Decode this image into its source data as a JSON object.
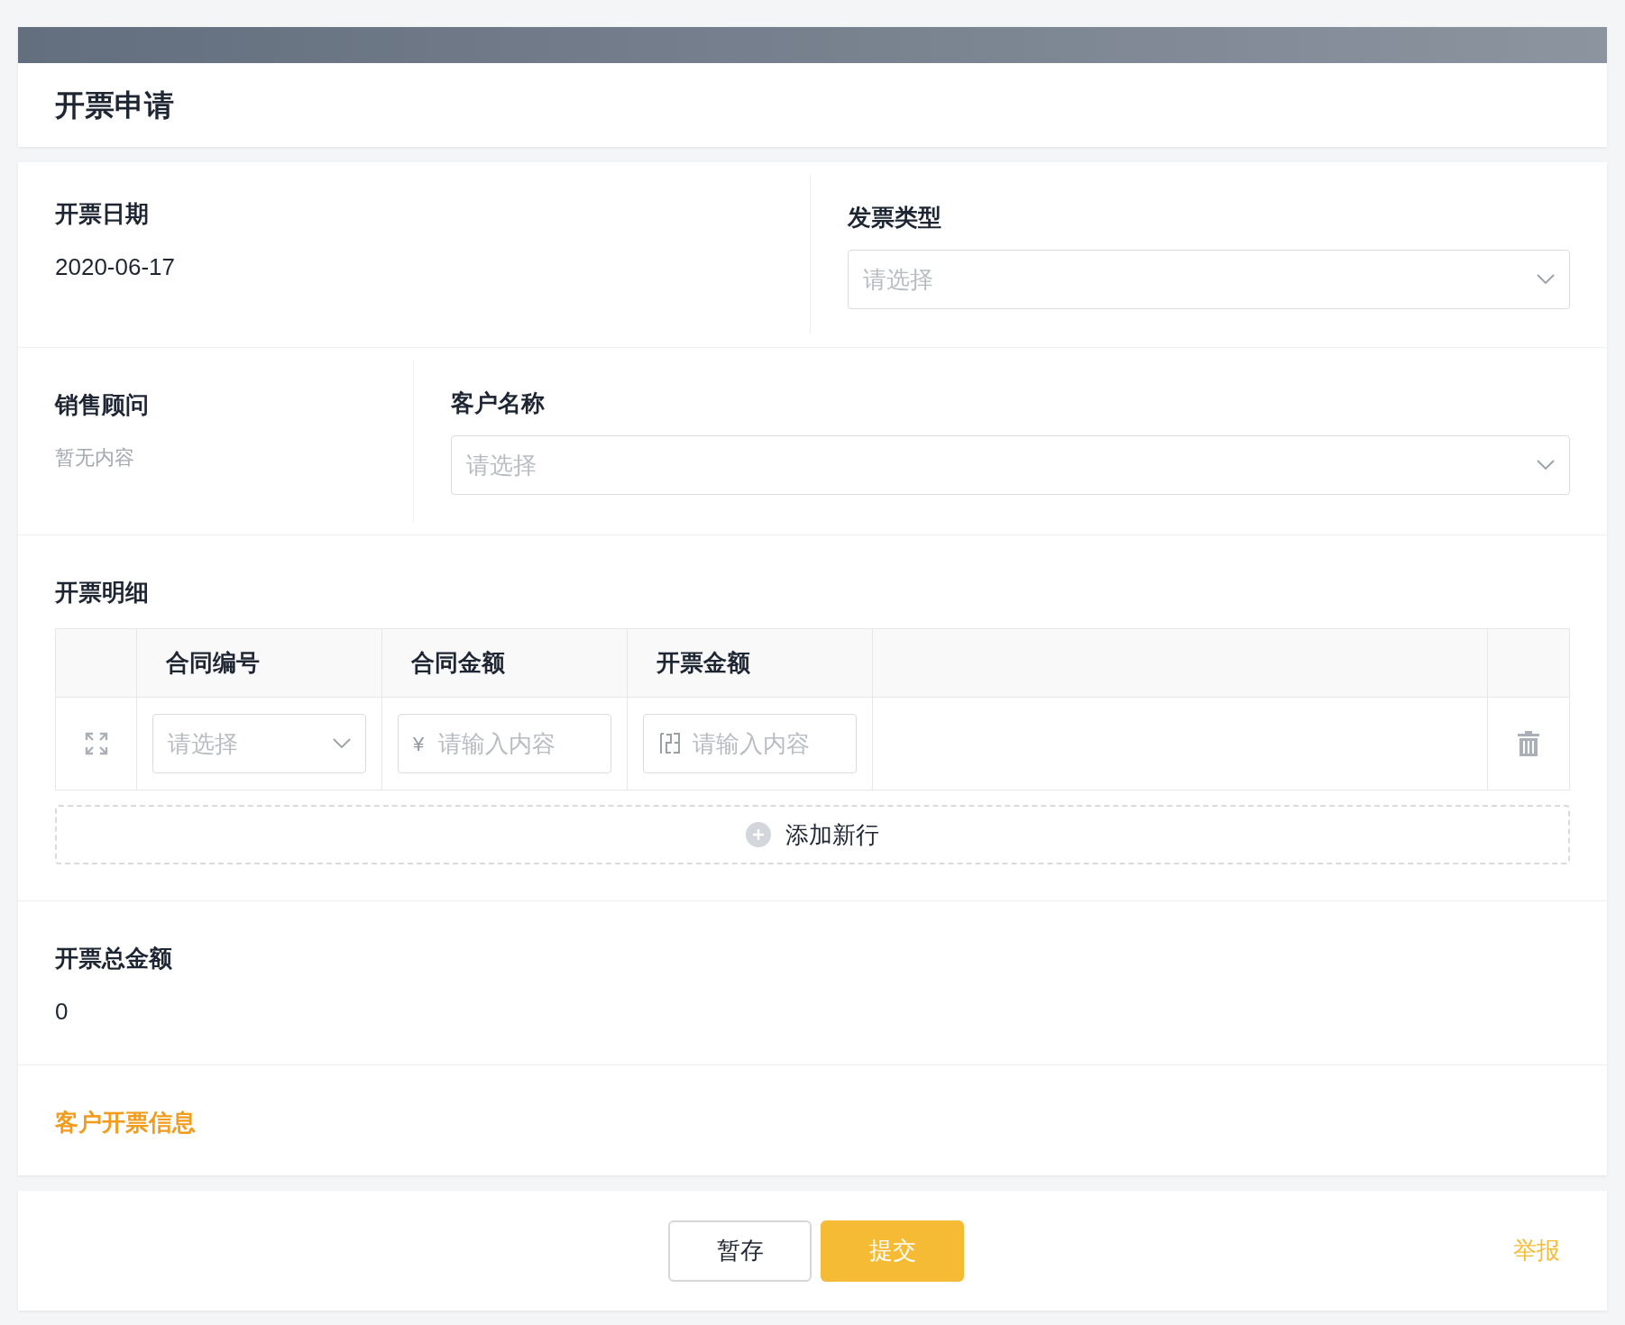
{
  "page_title": "开票申请",
  "invoice_date": {
    "label": "开票日期",
    "value": "2020-06-17"
  },
  "invoice_type": {
    "label": "发票类型",
    "placeholder": "请选择"
  },
  "sales_advisor": {
    "label": "销售顾问",
    "value": "暂无内容"
  },
  "customer_name": {
    "label": "客户名称",
    "placeholder": "请选择"
  },
  "details": {
    "label": "开票明细",
    "columns": [
      "合同编号",
      "合同金额",
      "开票金额"
    ],
    "rows": [
      {
        "contract_no": {
          "placeholder": "请选择"
        },
        "contract_amount": {
          "prefix": "¥",
          "placeholder": "请输入内容"
        },
        "invoice_amount": {
          "placeholder": "请输入内容"
        }
      }
    ],
    "add_row": "添加新行"
  },
  "total": {
    "label": "开票总金额",
    "value": "0"
  },
  "customer_invoice_info": "客户开票信息",
  "footer": {
    "buttons": [
      {
        "label": "暂存",
        "kind": "secondary"
      },
      {
        "label": "提交",
        "kind": "primary"
      }
    ],
    "report_link": "举报"
  }
}
